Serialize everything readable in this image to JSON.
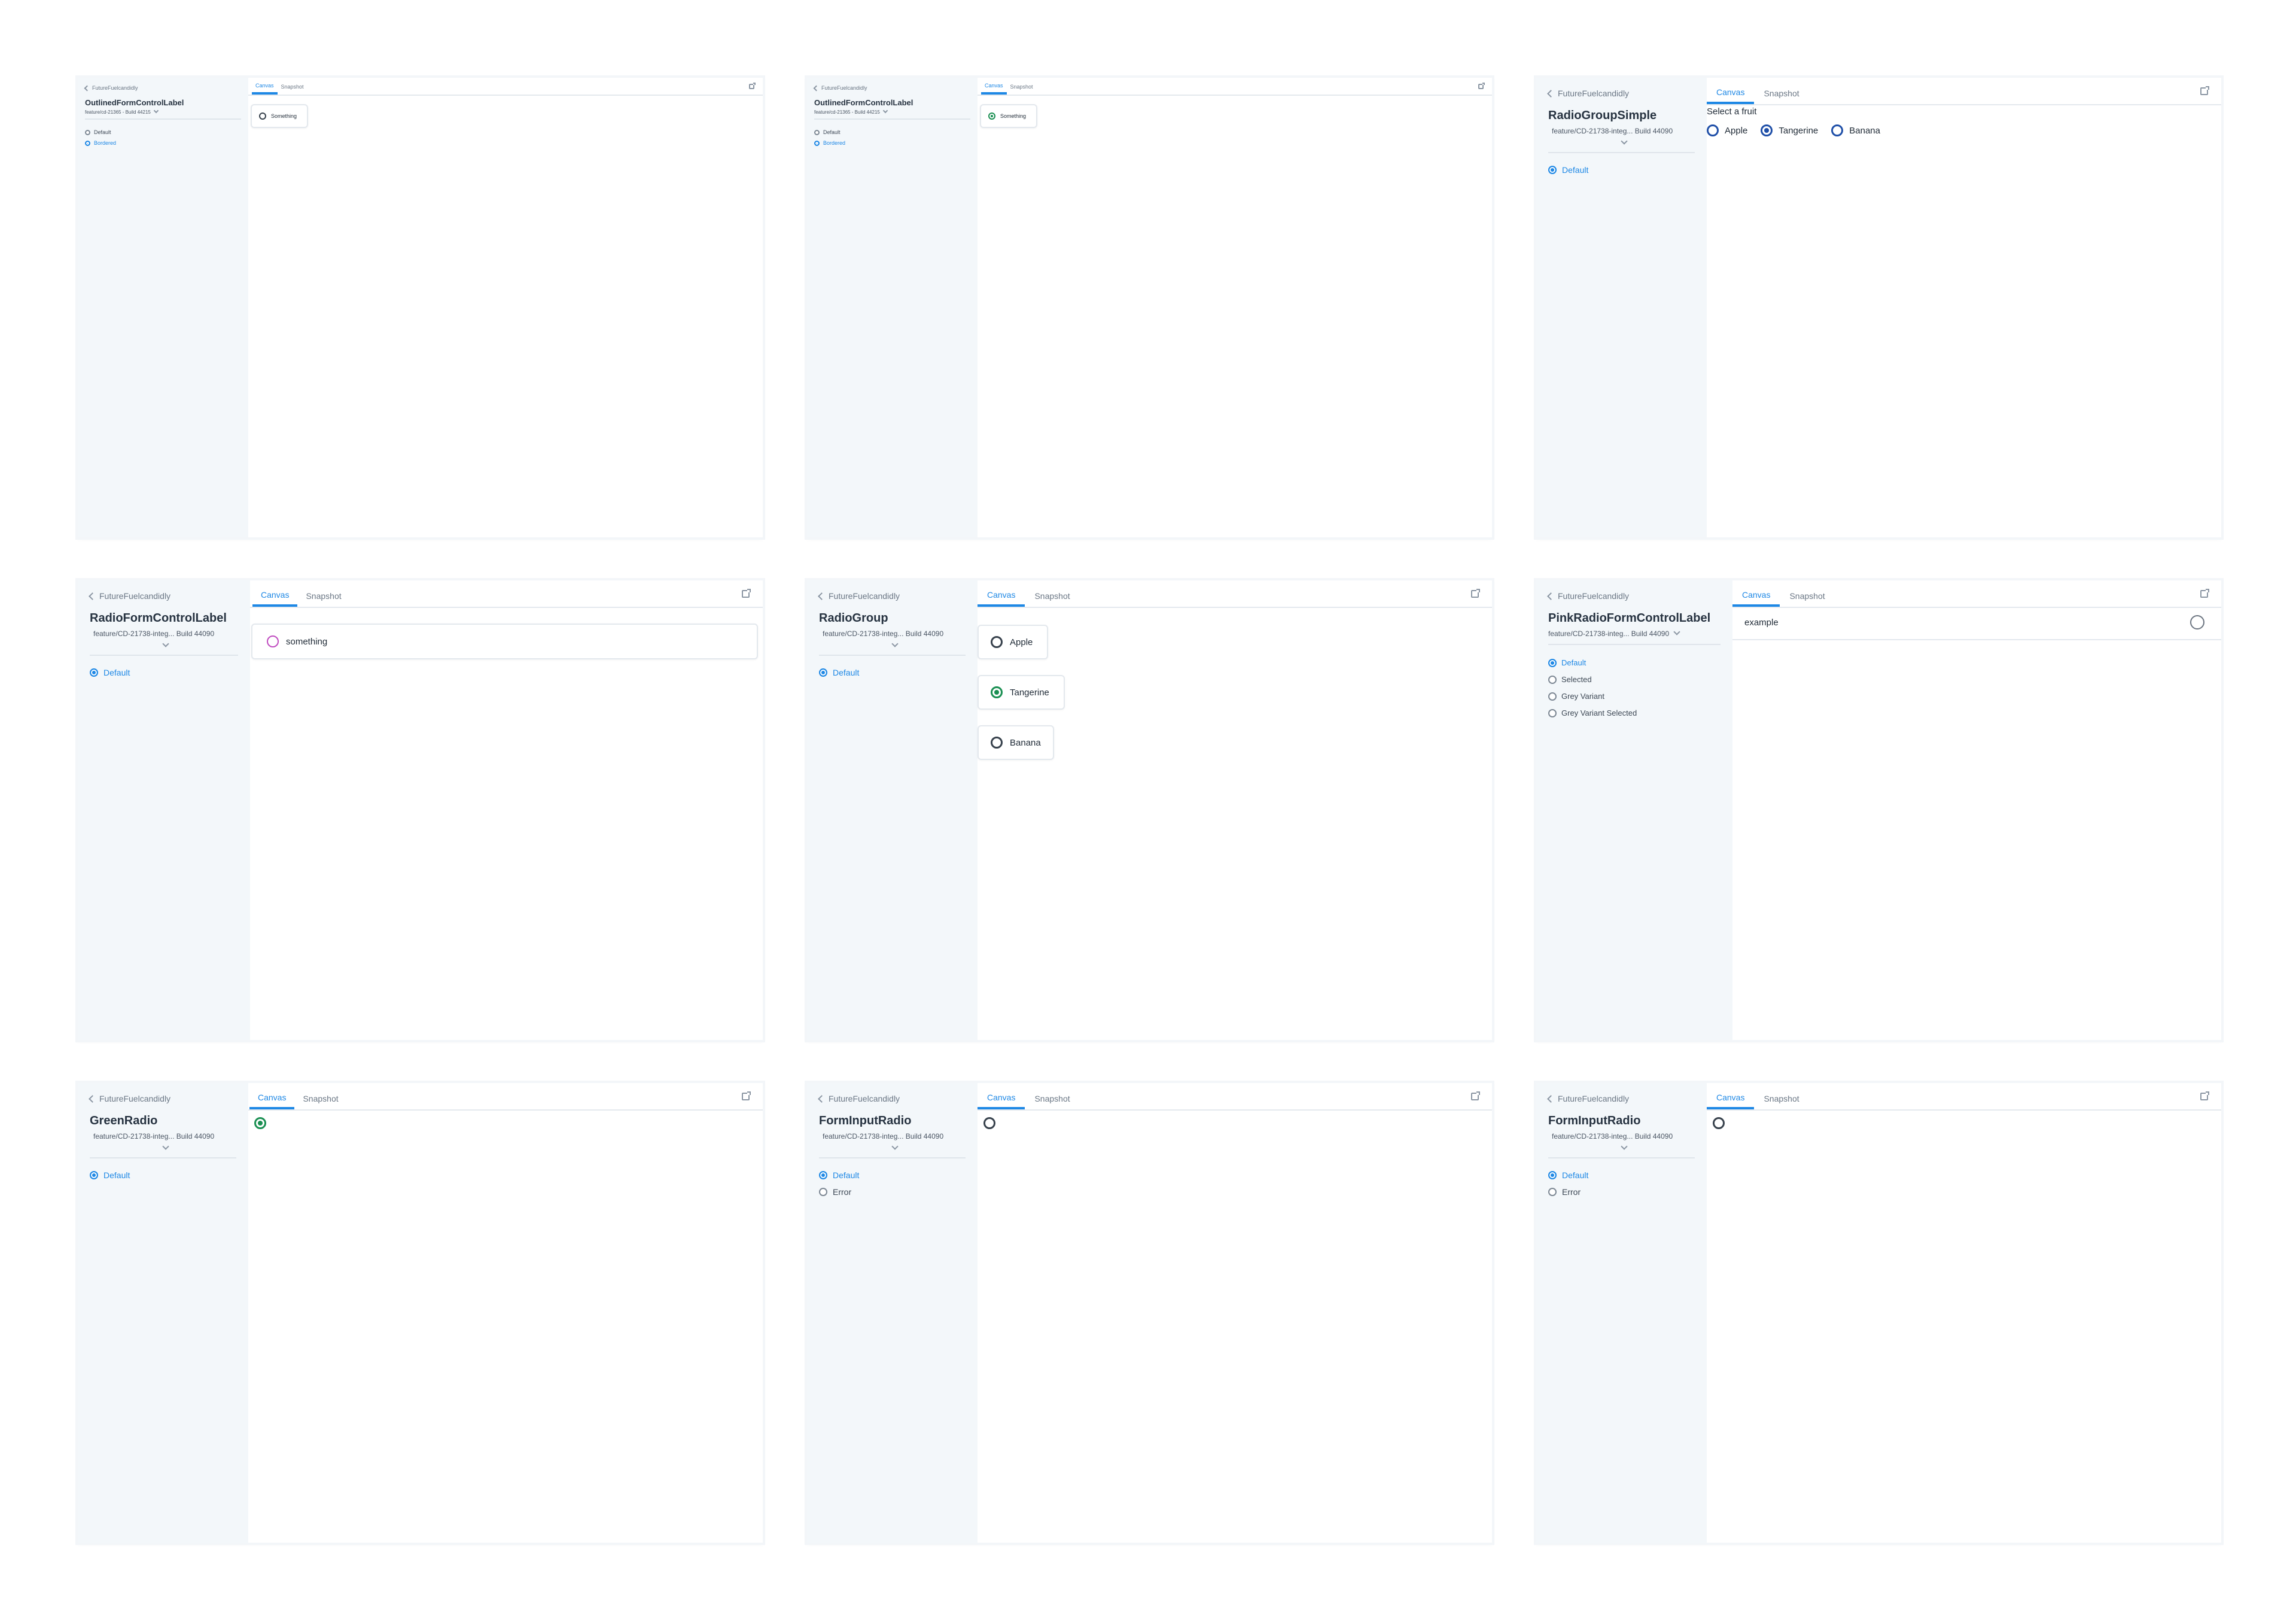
{
  "panels": [
    {
      "back_label": "FutureFuelcandidly",
      "component_title": "OutlinedFormControlLabel",
      "branch": "feature/cd-21365 - Build 44215",
      "variants": [
        {
          "label": "Default",
          "active": false
        },
        {
          "label": "Bordered",
          "active": true
        }
      ],
      "tabs": [
        "Canvas",
        "Snapshot"
      ],
      "canvas": {
        "kind": "outlined",
        "label": "Something",
        "selected": false
      }
    },
    {
      "back_label": "FutureFuelcandidly",
      "component_title": "OutlinedFormControlLabel",
      "branch": "feature/cd-21365 - Build 44215",
      "variants": [
        {
          "label": "Default",
          "active": false
        },
        {
          "label": "Bordered",
          "active": true
        }
      ],
      "tabs": [
        "Canvas",
        "Snapshot"
      ],
      "canvas": {
        "kind": "outlined",
        "label": "Something",
        "selected": true
      }
    },
    {
      "back_label": "FutureFuelcandidly",
      "component_title": "RadioGroupSimple",
      "branch": "feature/CD-21738-integ... Build 44090",
      "variants": [
        {
          "label": "Default",
          "active": true
        }
      ],
      "tabs": [
        "Canvas",
        "Snapshot"
      ],
      "canvas": {
        "kind": "simple-group",
        "heading": "Select a fruit",
        "options": [
          "Apple",
          "Tangerine",
          "Banana"
        ],
        "selected_index": 1
      }
    },
    {
      "back_label": "FutureFuelcandidly",
      "component_title": "RadioFormControlLabel",
      "branch": "feature/CD-21738-integ... Build 44090",
      "variants": [
        {
          "label": "Default",
          "active": true
        }
      ],
      "tabs": [
        "Canvas",
        "Snapshot"
      ],
      "canvas": {
        "kind": "full-card",
        "label": "something"
      }
    },
    {
      "back_label": "FutureFuelcandidly",
      "component_title": "RadioGroup",
      "branch": "feature/CD-21738-integ... Build 44090",
      "variants": [
        {
          "label": "Default",
          "active": true
        }
      ],
      "tabs": [
        "Canvas",
        "Snapshot"
      ],
      "canvas": {
        "kind": "card-group",
        "options": [
          "Apple",
          "Tangerine",
          "Banana"
        ],
        "selected_index": 1
      }
    },
    {
      "back_label": "FutureFuelcandidly",
      "component_title": "PinkRadioFormControlLabel",
      "branch": "feature/CD-21738-integ... Build 44090",
      "variants": [
        {
          "label": "Default",
          "active": true
        },
        {
          "label": "Selected",
          "active": false
        },
        {
          "label": "Grey Variant",
          "active": false
        },
        {
          "label": "Grey Variant Selected",
          "active": false
        }
      ],
      "tabs": [
        "Canvas",
        "Snapshot"
      ],
      "canvas": {
        "kind": "row-right",
        "label": "example"
      }
    },
    {
      "back_label": "FutureFuelcandidly",
      "component_title": "GreenRadio",
      "branch": "feature/CD-21738-integ... Build 44090",
      "variants": [
        {
          "label": "Default",
          "active": true
        }
      ],
      "tabs": [
        "Canvas",
        "Snapshot"
      ],
      "canvas": {
        "kind": "single",
        "selected": true,
        "color": "green"
      }
    },
    {
      "back_label": "FutureFuelcandidly",
      "component_title": "FormInputRadio",
      "branch": "feature/CD-21738-integ... Build 44090",
      "variants": [
        {
          "label": "Default",
          "active": true
        },
        {
          "label": "Error",
          "active": false
        }
      ],
      "tabs": [
        "Canvas",
        "Snapshot"
      ],
      "canvas": {
        "kind": "single",
        "selected": false,
        "color": "dark"
      }
    },
    {
      "back_label": "FutureFuelcandidly",
      "component_title": "FormInputRadio",
      "branch": "feature/CD-21738-integ... Build 44090",
      "variants": [
        {
          "label": "Default",
          "active": true
        },
        {
          "label": "Error",
          "active": false
        }
      ],
      "tabs": [
        "Canvas",
        "Snapshot"
      ],
      "canvas": {
        "kind": "single",
        "selected": false,
        "color": "dark"
      }
    }
  ],
  "icons": {
    "back": "chevron-left-icon",
    "caret": "chevron-down-icon",
    "open_external": "open-external-icon",
    "radio": "radio-icon"
  },
  "colors": {
    "accent": "#1e88e5",
    "green": "#1a8f52",
    "navy": "#1f4fa8",
    "pink": "#c04cc0",
    "sidebar": "#f3f7fa"
  }
}
